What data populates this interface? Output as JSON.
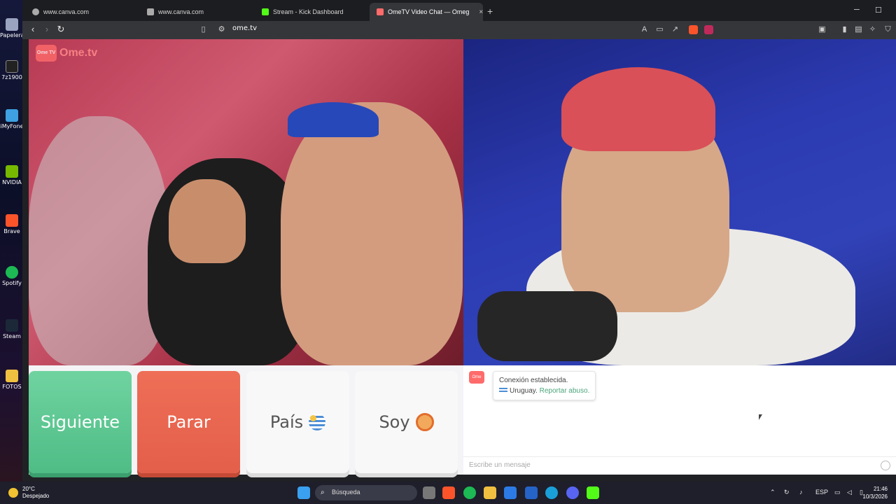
{
  "desktop": {
    "icons": [
      "Papelera de reciclaje",
      "7z1900",
      "iMyFone",
      "NVIDIA",
      "Brave",
      "Spotify",
      "Steam",
      "FOTOS"
    ]
  },
  "browser": {
    "tabs": [
      {
        "title": "www.canva.com"
      },
      {
        "title": "www.canva.com"
      },
      {
        "title": "Stream - Kick Dashboard"
      },
      {
        "title": "OmeTV Video Chat — Omeg"
      }
    ],
    "new_tab": "+",
    "url": "ome.tv",
    "win_minimize": "─",
    "win_maximize": "☐",
    "tab_close": "×"
  },
  "page": {
    "logo_badge": "Ome TV",
    "logo_text": "Ome.tv",
    "buttons": {
      "next": "Siguiente",
      "stop": "Parar",
      "country": "País",
      "gender": "Soy"
    },
    "chat": {
      "avatar_label": "Ome TV",
      "status": "Conexión establecida.",
      "country": "Uruguay.",
      "report_link": "Reportar abuso.",
      "input_placeholder": "Escribe un mensaje"
    }
  },
  "taskbar": {
    "weather_temp": "20°C",
    "weather_desc": "Despejado",
    "search_placeholder": "Búsqueda",
    "language": "ESP",
    "time": "21:46",
    "date": "10/3/2026"
  },
  "colors": {
    "next_button": "#5ec793",
    "stop_button": "#e8654f",
    "report_link": "#4aa57a"
  }
}
